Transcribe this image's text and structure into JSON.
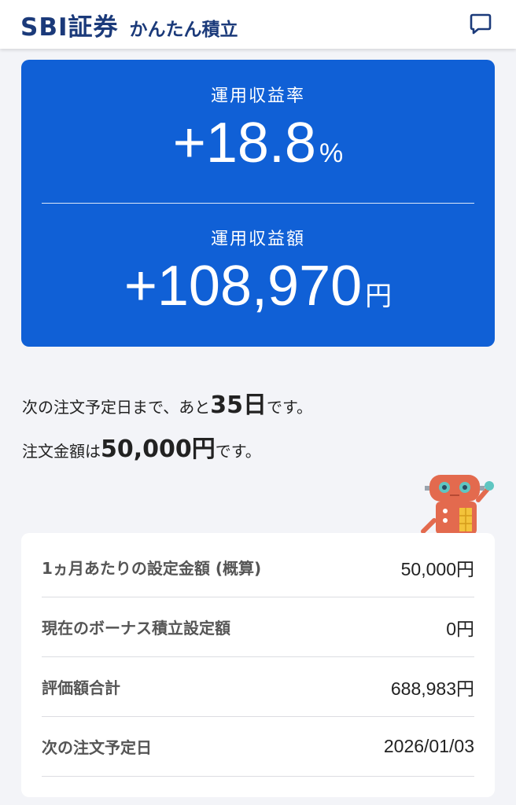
{
  "header": {
    "logo": "SBI証券",
    "subtitle": "かんたん積立",
    "chat_icon": "chat-bubble-icon"
  },
  "summary": {
    "rate_label": "運用収益率",
    "rate_value": "+18.8",
    "rate_unit": "%",
    "amount_label": "運用収益額",
    "amount_value": "+108,970",
    "amount_unit": "円",
    "background_color": "#1060d6"
  },
  "info": {
    "line1_prefix": "次の注文予定日まで、あと",
    "line1_value": "35日",
    "line1_suffix": "です。",
    "line2_prefix": "注文金額は",
    "line2_value": "50,000円",
    "line2_suffix": "です。"
  },
  "details": [
    {
      "label": "1ヵ月あたりの設定金額 (概算)",
      "value": "50,000円"
    },
    {
      "label": "現在のボーナス積立設定額",
      "value": "0円"
    },
    {
      "label": "評価額合計",
      "value": "688,983円"
    },
    {
      "label": "次の注文予定日",
      "value": "2026/01/03"
    }
  ]
}
